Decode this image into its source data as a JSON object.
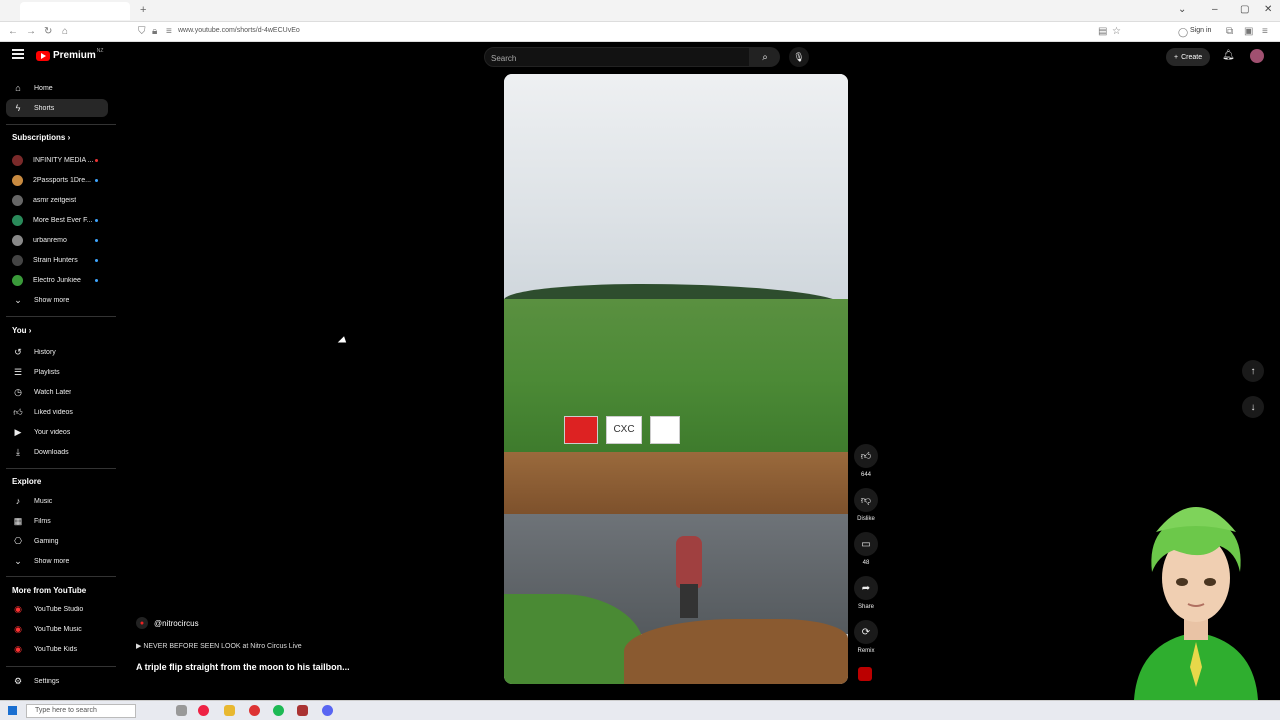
{
  "browser": {
    "tab_title": "",
    "url": "www.youtube.com/shorts/d-4wECUvEo",
    "signin_label": "Sign in"
  },
  "masthead": {
    "logo_text": "Premium",
    "logo_sup": "NZ",
    "search_placeholder": "Search",
    "create_label": "Create"
  },
  "sidebar": {
    "main": [
      {
        "label": "Home",
        "icon": "home-icon"
      },
      {
        "label": "Shorts",
        "icon": "shorts-icon"
      }
    ],
    "subscriptions_title": "Subscriptions",
    "subscriptions": [
      {
        "label": "INFINITY MEDIA ...",
        "color": "#7a2a2a"
      },
      {
        "label": "2Passports 1Dre...",
        "color": "#c88a40"
      },
      {
        "label": "asmr zeitgeist",
        "color": "#666"
      },
      {
        "label": "More Best Ever F...",
        "color": "#2a8a5a"
      },
      {
        "label": "urbanremo",
        "color": "#888"
      },
      {
        "label": "Strain Hunters",
        "color": "#444"
      },
      {
        "label": "Electro Junkiee",
        "color": "#3a9a3a"
      }
    ],
    "show_more": "Show more",
    "you_title": "You",
    "you": [
      {
        "label": "History",
        "icon": "history-icon"
      },
      {
        "label": "Playlists",
        "icon": "playlists-icon"
      },
      {
        "label": "Watch Later",
        "icon": "clock-icon"
      },
      {
        "label": "Liked videos",
        "icon": "thumbs-up-icon"
      },
      {
        "label": "Your videos",
        "icon": "video-icon"
      },
      {
        "label": "Downloads",
        "icon": "download-icon"
      }
    ],
    "explore_title": "Explore",
    "explore": [
      {
        "label": "Music",
        "icon": "music-icon"
      },
      {
        "label": "Films",
        "icon": "film-icon"
      },
      {
        "label": "Gaming",
        "icon": "gaming-icon"
      }
    ],
    "show_more_2": "Show more",
    "more_title": "More from YouTube",
    "more": [
      {
        "label": "YouTube Studio"
      },
      {
        "label": "YouTube Music"
      },
      {
        "label": "YouTube Kids"
      }
    ],
    "settings": "Settings"
  },
  "short": {
    "channel": "@nitrocircus",
    "playlist": "▶ NEVER BEFORE SEEN LOOK at Nitro Circus Live",
    "title": "A triple flip straight from the moon to his tailbon...",
    "likes": "644",
    "dislike": "Dislike",
    "comments": "48",
    "share": "Share",
    "remix": "Remix",
    "banners": [
      "",
      "CXC",
      ""
    ]
  },
  "taskbar": {
    "search_placeholder": "Type here to search"
  }
}
